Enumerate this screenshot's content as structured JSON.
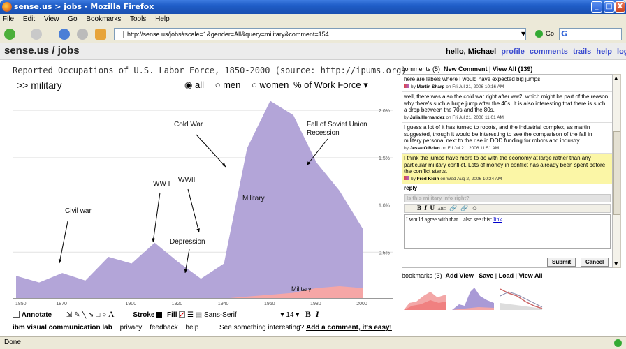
{
  "window": {
    "title": "sense.us > jobs - Mozilla Firefox",
    "controls": [
      "_",
      "□",
      "X"
    ]
  },
  "menu": [
    "File",
    "Edit",
    "View",
    "Go",
    "Bookmarks",
    "Tools",
    "Help"
  ],
  "nav": {
    "url": "http://sense.us/jobs#scale=1&gender=All&query=military&comment=154",
    "go_label": "Go"
  },
  "site": {
    "logo": "sense.us / jobs",
    "greeting": "hello, Michael",
    "links": [
      "profile",
      "comments",
      "trails",
      "help",
      "logout"
    ]
  },
  "chart_header": {
    "title": "Reported Occupations of U.S. Labor Force, 1850-2000 (source: http://ipums.org)",
    "query": ">> military",
    "radio_all": "all",
    "radio_men": "men",
    "radio_women": "women",
    "measure": "% of Work Force"
  },
  "chart_data": {
    "type": "area",
    "x": [
      1850,
      1860,
      1870,
      1880,
      1890,
      1900,
      1910,
      1920,
      1930,
      1940,
      1950,
      1960,
      1970,
      1980,
      1990,
      2000
    ],
    "series": [
      {
        "name": "Military",
        "values": [
          0.25,
          0.18,
          0.28,
          0.2,
          0.45,
          0.38,
          0.6,
          0.4,
          0.22,
          0.38,
          1.6,
          2.1,
          1.95,
          1.45,
          1.15,
          0.75
        ],
        "color": "#b3a5d8"
      },
      {
        "name": "Military",
        "values": [
          0.0,
          0.0,
          0.0,
          0.0,
          0.0,
          0.0,
          0.0,
          0.0,
          0.0,
          0.01,
          0.03,
          0.05,
          0.07,
          0.12,
          0.14,
          0.12
        ],
        "color": "#f5a6a6"
      }
    ],
    "ylim": [
      0,
      2.2
    ],
    "yticks": [
      "0.5%",
      "1.0%",
      "1.5%",
      "2.0%"
    ],
    "ytick_values": [
      0.5,
      1.0,
      1.5,
      2.0
    ],
    "xticks": [
      "1850",
      "1870",
      "1900",
      "1920",
      "1940",
      "1960",
      "1980",
      "2000"
    ],
    "xtick_values": [
      1850,
      1870,
      1900,
      1920,
      1940,
      1960,
      1980,
      2000
    ],
    "annotations": {
      "civil_war": "Civil war",
      "ww1": "WW I",
      "ww2": "WWII",
      "depression": "Depression",
      "cold_war": "Cold War",
      "soviet_1": "Fall of Soviet Union",
      "soviet_2": "Recession",
      "military_label": "Military",
      "military_small": "Military"
    },
    "grid": true
  },
  "draw_toolbar": {
    "annotate": "Annotate",
    "stroke": "Stroke",
    "fill": "Fill",
    "font": "Sans-Serif",
    "size": "14",
    "bold": "B",
    "italic": "I"
  },
  "footer": {
    "links": [
      "ibm visual communication lab",
      "privacy",
      "feedback",
      "help"
    ],
    "prompt": "See something interesting?",
    "cta": "Add a comment, it's easy!"
  },
  "comments": {
    "header": "comments (5)",
    "new": "New Comment",
    "view_all": "View All (139)",
    "items": [
      {
        "text": "here are labels where I would have expected big jumps.",
        "author": "Martin Sharp",
        "date": "on Fri Jul 21, 2006 10:16 AM"
      },
      {
        "text": "well, there was also the cold war right after ww2, which might be part of the reason why there's such a huge jump after the 40s. It is also interesting that there is such a drop between the 70s and the 80s.",
        "author": "Julia Hernandez",
        "date": "on Fri Jul 21, 2006 11:01 AM"
      },
      {
        "text": "I guess a lot of it has turned to robots, and the industrial complex, as martin suggested, though it would be interesting to see the comparison of the fall in military personal next to the rise in DOD funding for robots and industry.",
        "author": "Jesse O'Brien",
        "date": "on Fri Jul 21, 2006 11:51 AM"
      },
      {
        "text": "I think the jumps have more to do with the economy at large rather than any particular military conflict. Lots of money in conflict has already been spent before the conflict starts.",
        "author": "Fred Klein",
        "date": "on Wed Aug 2, 2006 10:24 AM"
      }
    ],
    "reply": "reply",
    "subject_placeholder": "Is this military info right?",
    "reply_text": "I would agree with that... also see this:",
    "reply_link": "link",
    "submit": "Submit",
    "cancel": "Cancel"
  },
  "bookmarks": {
    "header": "bookmarks (3)",
    "add": "Add View",
    "save": "Save",
    "load": "Load",
    "view_all": "View All"
  },
  "status": "Done"
}
